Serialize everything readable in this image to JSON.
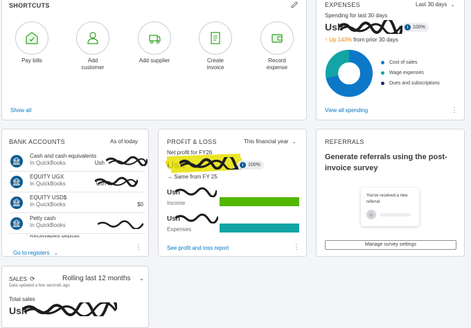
{
  "shortcuts": {
    "title": "SHORTCUTS",
    "items": [
      {
        "label_1": "Pay bills",
        "label_2": ""
      },
      {
        "label_1": "Add",
        "label_2": "customer"
      },
      {
        "label_1": "Add supplier",
        "label_2": ""
      },
      {
        "label_1": "Create",
        "label_2": "invoice"
      },
      {
        "label_1": "Record",
        "label_2": "expense"
      }
    ],
    "show_all": "Show all"
  },
  "expenses": {
    "title": "EXPENSES",
    "period": "Last 30 days",
    "subtitle": "Spending for last 30 days",
    "amount_prefix": "Ush",
    "badge": "100%",
    "change": "Up 143%",
    "change_suffix": "from prior 30 days",
    "legend": [
      "Cost of sales",
      "Wage expenses",
      "Dues and subscriptions"
    ],
    "view_all": "View all spending"
  },
  "bank_accounts": {
    "title": "BANK ACCOUNTS",
    "as_of": "As of today",
    "rows": [
      {
        "name": "Cash and cash equivalents",
        "sub": "In QuickBooks",
        "balance": "Ush"
      },
      {
        "name": "EQUITY UGX",
        "sub": "In QuickBooks",
        "balance": "Ush"
      },
      {
        "name": "EQUITY USD$",
        "sub": "In QuickBooks",
        "balance": "$0"
      },
      {
        "name": "Petty cash",
        "sub": "In QuickBooks",
        "balance": ""
      }
    ],
    "partial_row": "Receivables deposit",
    "go_to_registers": "Go to registers"
  },
  "profit_loss": {
    "title": "PROFIT & LOSS",
    "period": "This financial year",
    "subtitle": "Net profit for FY26",
    "amount_prefix": "Ush",
    "badge": "100%",
    "change": "Same from FY 25",
    "income_label": "Income",
    "expenses_label": "Expenses",
    "income_amount_prefix": "Ush",
    "expenses_amount_prefix": "Ush",
    "report_link": "See profit and loss report",
    "income_color": "#53b700",
    "expenses_color": "#13a5a5"
  },
  "referrals": {
    "title": "REFERRALS",
    "heading": "Generate referrals using the post-invoice survey",
    "card_text": "You've received a new referral",
    "button": "Manage survey settings"
  },
  "sales": {
    "title": "SALES",
    "period": "Rolling last 12 months",
    "updated": "Data updated a few seconds ago",
    "total_label": "Total sales",
    "amount_prefix": "Ush"
  },
  "colors": {
    "accent": "#0077c5",
    "navy": "#0d5c91",
    "donut_blue": "#0d78c8",
    "donut_teal": "#13a5a5",
    "up_orange": "#ec7e00"
  }
}
